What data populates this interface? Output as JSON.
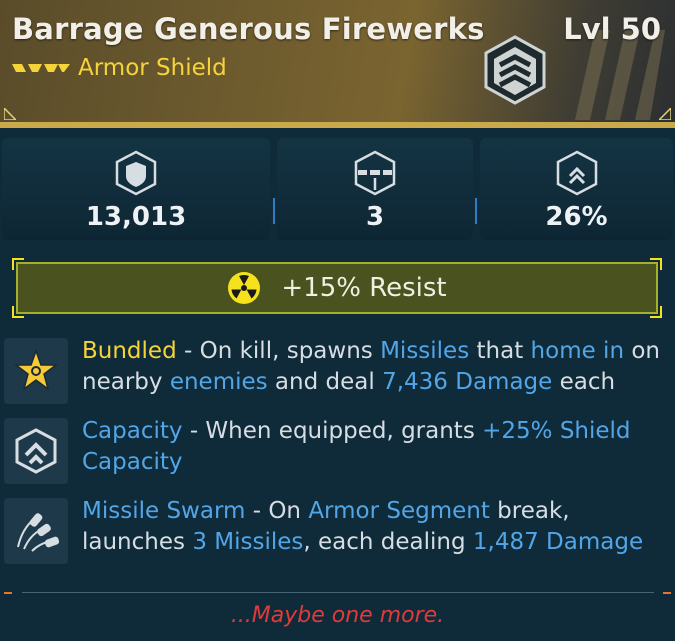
{
  "item": {
    "name": "Barrage Generous Firewerks",
    "level": "Lvl 50",
    "type": "Armor Shield",
    "rarity_icon": "legendary-chevrons-icon",
    "badge_icon": "armor-shield-badge-icon"
  },
  "stats": [
    {
      "icon": "shield-capacity-icon",
      "value": "13,013"
    },
    {
      "icon": "armor-segments-icon",
      "value": "3"
    },
    {
      "icon": "recharge-rate-icon",
      "value": "26%"
    }
  ],
  "element": {
    "icon": "radiation-icon",
    "text": "+15% Resist"
  },
  "perks": [
    {
      "icon": "bundled-star-icon",
      "parts": [
        {
          "t": "Bundled",
          "c": "gold"
        },
        {
          "t": " - On kill, spawns ",
          "c": ""
        },
        {
          "t": "Missiles",
          "c": "blue"
        },
        {
          "t": " that ",
          "c": ""
        },
        {
          "t": "home in",
          "c": "blue"
        },
        {
          "t": " on nearby ",
          "c": ""
        },
        {
          "t": "enemies",
          "c": "blue"
        },
        {
          "t": " and deal ",
          "c": ""
        },
        {
          "t": "7,436 Damage",
          "c": "blue"
        },
        {
          "t": " each",
          "c": ""
        }
      ]
    },
    {
      "icon": "capacity-shield-icon",
      "parts": [
        {
          "t": "Capacity",
          "c": "blue"
        },
        {
          "t": " - When equipped, grants ",
          "c": ""
        },
        {
          "t": "+25% Shield Capacity",
          "c": "blue"
        }
      ]
    },
    {
      "icon": "missile-swarm-icon",
      "parts": [
        {
          "t": "Missile Swarm",
          "c": "blue"
        },
        {
          "t": " - On ",
          "c": ""
        },
        {
          "t": "Armor Segment",
          "c": "blue"
        },
        {
          "t": " break, launches ",
          "c": ""
        },
        {
          "t": "3 Missiles",
          "c": "blue"
        },
        {
          "t": ", each dealing ",
          "c": ""
        },
        {
          "t": "1,487 Damage",
          "c": "blue"
        }
      ]
    }
  ],
  "flavor_text": "...Maybe one more.",
  "colors": {
    "gold": "#f5d43a",
    "blue": "#52a6e8",
    "flavor": "#e03b3b",
    "element_bar": "#4a5320"
  }
}
